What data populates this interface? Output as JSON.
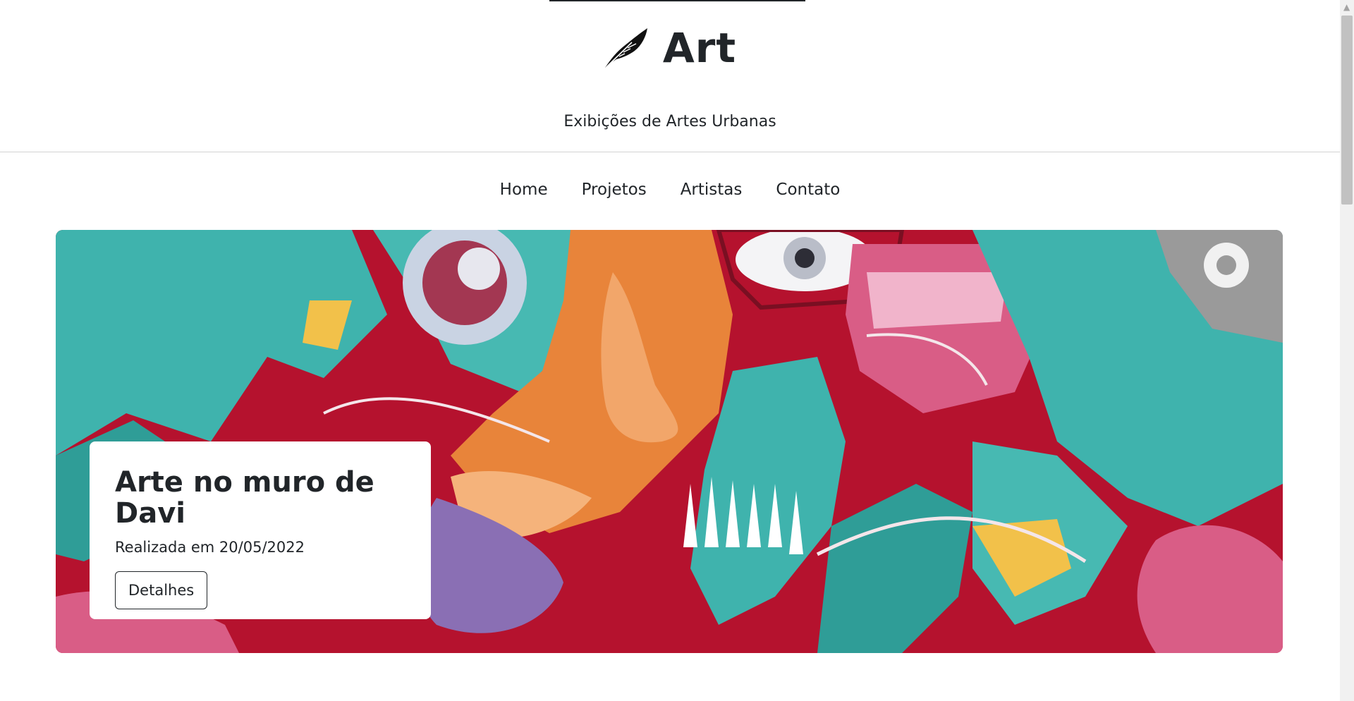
{
  "brand": {
    "name": "Art",
    "icon": "feather-icon",
    "subtitle": "Exibições de Artes Urbanas"
  },
  "nav": {
    "items": [
      {
        "label": "Home"
      },
      {
        "label": "Projetos"
      },
      {
        "label": "Artistas"
      },
      {
        "label": "Contato"
      }
    ]
  },
  "hero": {
    "title": "Arte no muro de Davi",
    "date": "Realizada em 20/05/2022",
    "button_label": "Detalhes",
    "image": "graffiti-mural",
    "colors": {
      "teal": "#3fb3ad",
      "crimson": "#b5122e",
      "orange": "#e8843a",
      "purple": "#8a6fb4",
      "pink": "#d95d86",
      "gray": "#9a9a9a"
    }
  },
  "scrollbar": {
    "up_icon": "chevron-up-icon"
  }
}
